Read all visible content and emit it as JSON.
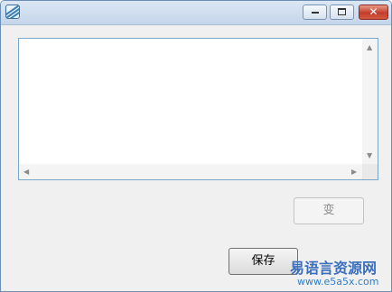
{
  "window": {
    "controls": {
      "close_symbol": "✕"
    }
  },
  "buttons": {
    "change_label": "变",
    "save_label": "保存"
  },
  "textbox": {
    "value": ""
  },
  "watermark": {
    "title": "易语言资源网",
    "url": "www.e5a5x.com"
  }
}
